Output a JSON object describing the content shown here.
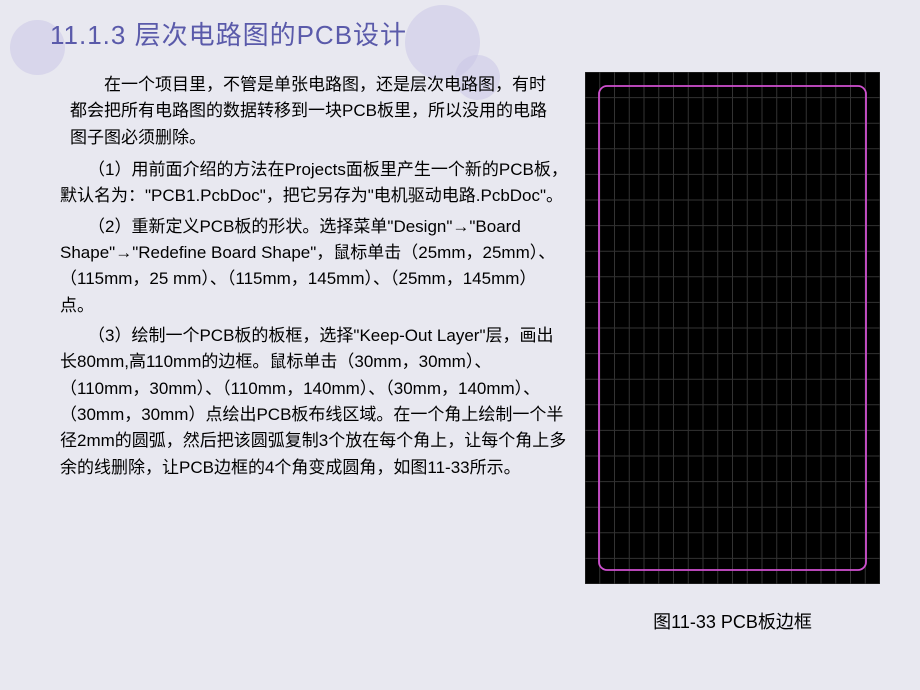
{
  "title": "11.1.3 层次电路图的PCB设计",
  "intro": "在一个项目里，不管是单张电路图，还是层次电路图，有时都会把所有电路图的数据转移到一块PCB板里，所以没用的电路图子图必须删除。",
  "items": [
    "（1）用前面介绍的方法在Projects面板里产生一个新的PCB板，默认名为：\"PCB1.PcbDoc\"，把它另存为\"电机驱动电路.PcbDoc\"。",
    "（2）重新定义PCB板的形状。选择菜单\"Design\"→\"Board Shape\"→\"Redefine Board Shape\"，鼠标单击（25mm，25mm）、（115mm，25 mm）、（115mm，145mm）、（25mm，145mm）点。",
    "（3）绘制一个PCB板的板框，选择\"Keep-Out Layer\"层，画出长80mm,高110mm的边框。鼠标单击（30mm，30mm）、（110mm，30mm）、（110mm，140mm）、（30mm，140mm）、（30mm，30mm）点绘出PCB板布线区域。在一个角上绘制一个半径2mm的圆弧，然后把该圆弧复制3个放在每个角上，让每个角上多余的线删除，让PCB边框的4个角变成圆角，如图11-33所示。"
  ],
  "figure": {
    "caption": "图11-33 PCB板边框"
  }
}
